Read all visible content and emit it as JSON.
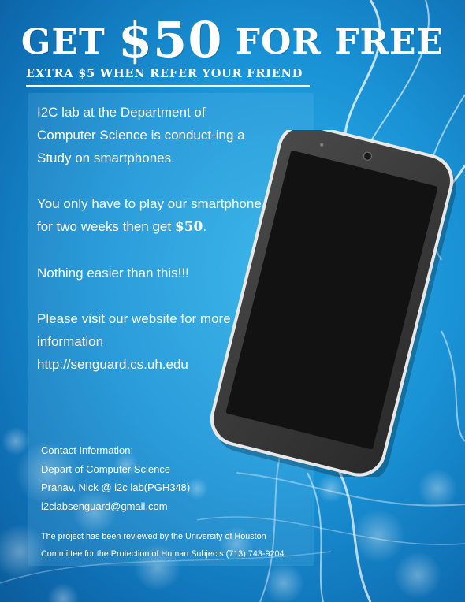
{
  "headline": {
    "part1": "GET ",
    "amount": "$50",
    "part2": " FOR FREE"
  },
  "subheadline": "EXTRA $5 WHEN REFER YOUR FRIEND",
  "body": {
    "paragraph1": "I2C lab at the Department of Computer Science is conduct-ing a Study on smartphones.",
    "paragraph2_prefix": "You only have to play our smartphone for two weeks then get ",
    "paragraph2_amount": "$50",
    "paragraph2_suffix": ".",
    "paragraph3": "Nothing easier than this!!!",
    "paragraph4_line1": "Please visit our website for more information",
    "paragraph4_url": "http://senguard.cs.uh.edu"
  },
  "contact": {
    "heading": "Contact Information:",
    "department": "Depart of Computer Science",
    "people": "Pranav, Nick @ i2c lab(PGH348)",
    "email": "i2clabsenguard@gmail.com"
  },
  "footer": {
    "line1": "The project has been reviewed by the University of Houston",
    "line2": "Committee for the Protection of Human Subjects (713) 743-9204."
  },
  "colors": {
    "background": "#1a93d6",
    "text": "#ffffff",
    "phone_body": "#3a3a3a",
    "phone_screen": "#111111"
  },
  "icons": {
    "phone": "smartphone-illustration"
  }
}
